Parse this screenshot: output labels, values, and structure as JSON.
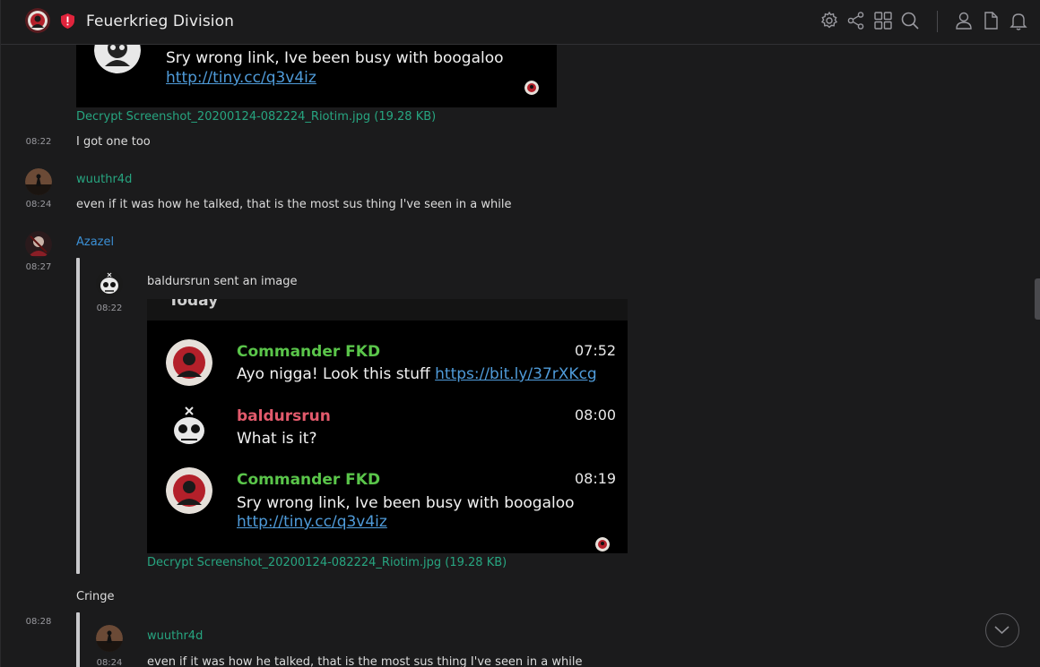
{
  "header": {
    "room_name": "Feuerkrieg Division",
    "icons": [
      "settings-icon",
      "share-icon",
      "apps-icon",
      "search-icon",
      "members-icon",
      "files-icon",
      "notifications-icon"
    ]
  },
  "colors": {
    "background": "#1b1b1c",
    "green_user": "#27a580",
    "blue_user": "#3b8fd4",
    "link": "#4f9bd9",
    "shot_green": "#5ac54a",
    "shot_red": "#e25a6c",
    "shield": "#e0243c"
  },
  "top_shot": {
    "text": "Sry wrong link, Ive been busy with boogaloo",
    "link": "http://tiny.cc/q3v4iz",
    "attachment": "Decrypt Screenshot_20200124-082224_Riotim.jpg (19.28 KB)"
  },
  "messages": {
    "m1_time": "08:22",
    "m1_text": "I got one too",
    "m2_user": "wuuthr4d",
    "m2_time": "08:24",
    "m2_text": "even if it was how he talked, that is the most sus thing I've seen in a while",
    "m3_user": "Azazel",
    "m3_time": "08:27",
    "m4_time": "08:28",
    "cringe": "Cringe"
  },
  "quote1": {
    "time": "08:22",
    "text": "baldursrun sent an image",
    "attachment": "Decrypt Screenshot_20200124-082224_Riotim.jpg (19.28 KB)"
  },
  "shot": {
    "today": "Today",
    "msgs": [
      {
        "name": "Commander FKD",
        "time": "07:52",
        "text": "Ayo nigga! Look this stuff ",
        "link": "https://bit.ly/37rXKcg"
      },
      {
        "name": "baldursrun",
        "time": "08:00",
        "text": "What is it?",
        "link": ""
      },
      {
        "name": "Commander FKD",
        "time": "08:19",
        "text": "Sry wrong link, Ive been busy with boogaloo",
        "link": "http://tiny.cc/q3v4iz"
      }
    ]
  },
  "quote2": {
    "user": "wuuthr4d",
    "time": "08:24",
    "text": "even if it was how he talked, that is the most sus thing I've seen in a while"
  }
}
